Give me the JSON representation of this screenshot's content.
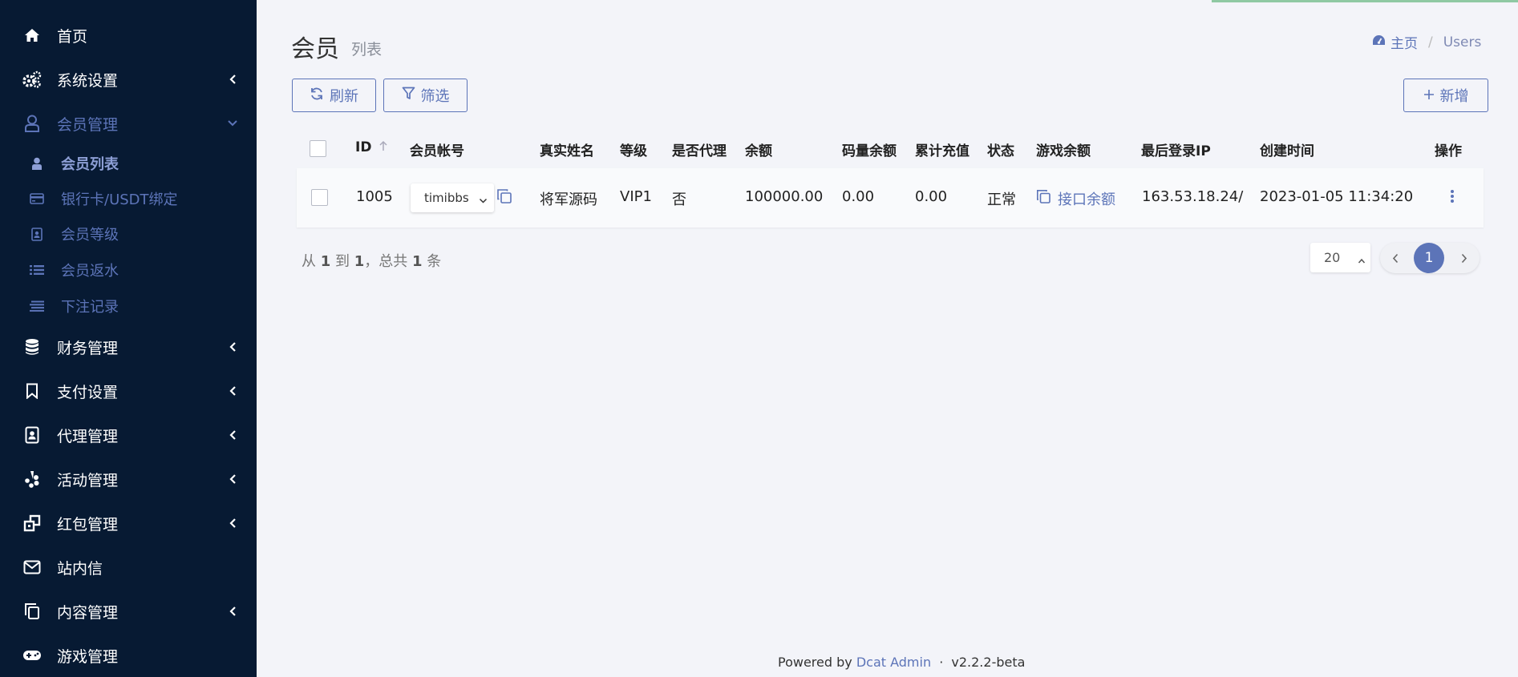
{
  "sidebar": {
    "items": [
      {
        "label": "首页",
        "icon": "home-icon"
      },
      {
        "label": "系统设置",
        "icon": "gears-icon"
      },
      {
        "label": "会员管理",
        "icon": "user-icon"
      },
      {
        "label": "财务管理",
        "icon": "database-icon"
      },
      {
        "label": "支付设置",
        "icon": "bookmark-icon"
      },
      {
        "label": "代理管理",
        "icon": "id-badge-icon"
      },
      {
        "label": "活动管理",
        "icon": "yelp-icon"
      },
      {
        "label": "红包管理",
        "icon": "clone-icon"
      },
      {
        "label": "站内信",
        "icon": "envelope-icon"
      },
      {
        "label": "内容管理",
        "icon": "copy-icon"
      },
      {
        "label": "游戏管理",
        "icon": "gamepad-icon"
      }
    ],
    "sub_items": [
      {
        "label": "会员列表",
        "icon": "user-small-icon"
      },
      {
        "label": "银行卡/USDT绑定",
        "icon": "credit-card-icon"
      },
      {
        "label": "会员等级",
        "icon": "address-card-icon"
      },
      {
        "label": "会员返水",
        "icon": "list-icon"
      },
      {
        "label": "下注记录",
        "icon": "align-icon"
      }
    ]
  },
  "header": {
    "title": "会员",
    "subtitle": "列表",
    "breadcrumb_home": "主页",
    "breadcrumb_current": "Users"
  },
  "toolbar": {
    "refresh_label": "刷新",
    "filter_label": "筛选",
    "add_label": "新增"
  },
  "table": {
    "headers": [
      "ID",
      "会员帐号",
      "真实姓名",
      "等级",
      "是否代理",
      "余额",
      "码量余额",
      "累计充值",
      "状态",
      "游戏余额",
      "最后登录IP",
      "创建时间",
      "操作"
    ],
    "rows": [
      {
        "id": "1005",
        "account": "timibbs",
        "real_name": "将军源码",
        "level": "VIP1",
        "is_agent": "否",
        "balance": "100000.00",
        "code_balance": "0.00",
        "total_recharge": "0.00",
        "status": "正常",
        "game_balance": "接口余额",
        "last_ip": "163.53.18.24/",
        "created_at": "2023-01-05 11:34:20"
      }
    ]
  },
  "pagination": {
    "from_label": "从",
    "from": "1",
    "to_label": "到",
    "to": "1",
    "total_label": "，总共",
    "total": "1",
    "unit": "条",
    "per_page": "20",
    "current_page": "1"
  },
  "footer": {
    "powered_by": "Powered by",
    "brand": "Dcat Admin",
    "dot": "·",
    "version": "v2.2.2-beta"
  },
  "colors": {
    "sidebar_bg": "#071a33",
    "accent": "#5c74b8",
    "page_bg": "#f3f4f9"
  }
}
